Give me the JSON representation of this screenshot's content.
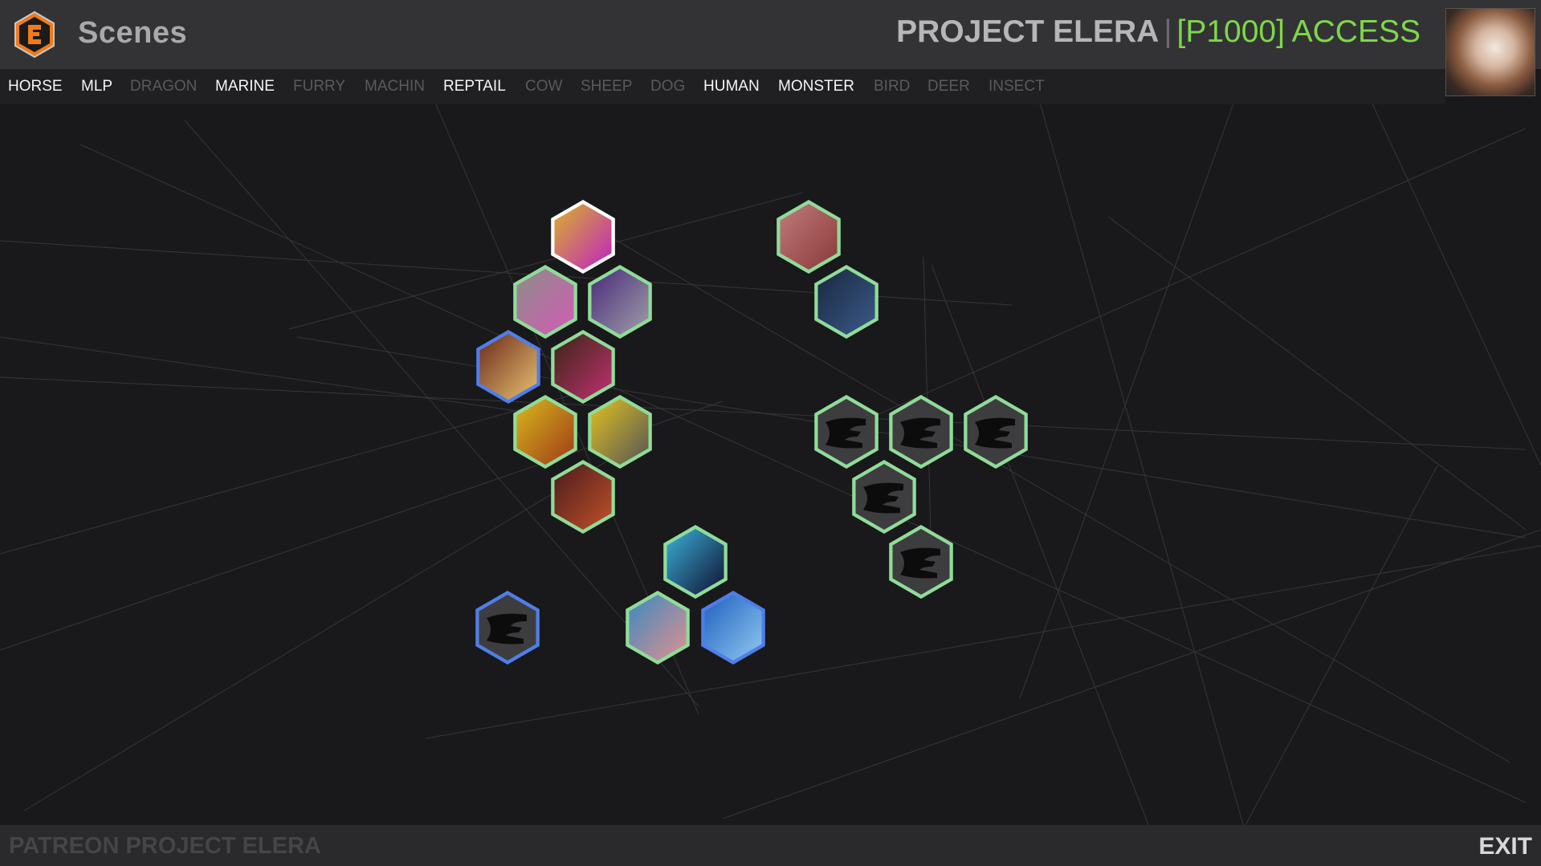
{
  "app": {
    "title": "Scenes",
    "project_name": "PROJECT ELERA",
    "separator": "|",
    "access_label": "[P1000] ACCESS"
  },
  "categories": [
    {
      "label": "HORSE",
      "active": true
    },
    {
      "label": "MLP",
      "active": true
    },
    {
      "label": "DRAGON",
      "active": false
    },
    {
      "label": "MARINE",
      "active": true
    },
    {
      "label": "FURRY",
      "active": false
    },
    {
      "label": "MACHIN",
      "active": false
    },
    {
      "label": "REPTAIL",
      "active": true
    },
    {
      "label": "COW",
      "active": false
    },
    {
      "label": "SHEEP",
      "active": false
    },
    {
      "label": "DOG",
      "active": false
    },
    {
      "label": "HUMAN",
      "active": true
    },
    {
      "label": "MONSTER",
      "active": true
    },
    {
      "label": "BIRD",
      "active": false
    },
    {
      "label": "DEER",
      "active": false
    },
    {
      "label": "INSECT",
      "active": false
    }
  ],
  "scenes": [
    {
      "name": "scene-yellow-pink-hair",
      "border": "white",
      "state": "selected",
      "thumb": [
        "#d9b22a",
        "#c022c0"
      ]
    },
    {
      "name": "scene-grey-pink",
      "border": "green",
      "state": "unlocked",
      "thumb": [
        "#8d8d86",
        "#d25bb8"
      ]
    },
    {
      "name": "scene-purple-stars",
      "border": "green",
      "state": "unlocked",
      "thumb": [
        "#4b2a7b",
        "#9e9ea8"
      ]
    },
    {
      "name": "scene-stable-sunset",
      "border": "blue",
      "state": "unlocked",
      "thumb": [
        "#6b2a1c",
        "#e8c070"
      ]
    },
    {
      "name": "scene-green-room",
      "border": "green",
      "state": "unlocked",
      "thumb": [
        "#3a2615",
        "#c03070"
      ]
    },
    {
      "name": "scene-yellow-body-1",
      "border": "green",
      "state": "unlocked",
      "thumb": [
        "#d6b81c",
        "#a03a18"
      ]
    },
    {
      "name": "scene-yellow-body-2",
      "border": "green",
      "state": "unlocked",
      "thumb": [
        "#e0c020",
        "#555555"
      ]
    },
    {
      "name": "scene-barn-night",
      "border": "green",
      "state": "unlocked",
      "thumb": [
        "#4a1c1c",
        "#c0502a"
      ]
    },
    {
      "name": "scene-flesh-close",
      "border": "green",
      "state": "unlocked",
      "thumb": [
        "#c07a7a",
        "#8a3a3a"
      ]
    },
    {
      "name": "scene-dark-blue",
      "border": "green",
      "state": "unlocked",
      "thumb": [
        "#1a2840",
        "#3a5a8a"
      ]
    },
    {
      "name": "scene-orca",
      "border": "green",
      "state": "unlocked",
      "thumb": [
        "#3ab0d8",
        "#101030"
      ]
    },
    {
      "name": "scene-water-pink",
      "border": "green",
      "state": "unlocked",
      "thumb": [
        "#3a8ac0",
        "#e09090"
      ]
    },
    {
      "name": "scene-pool",
      "border": "blue",
      "state": "unlocked",
      "thumb": [
        "#2060c0",
        "#90c8f0"
      ]
    },
    {
      "name": "scene-locked-1",
      "border": "green",
      "state": "locked",
      "thumb": []
    },
    {
      "name": "scene-locked-2",
      "border": "green",
      "state": "locked",
      "thumb": []
    },
    {
      "name": "scene-locked-3",
      "border": "green",
      "state": "locked",
      "thumb": []
    },
    {
      "name": "scene-locked-4",
      "border": "green",
      "state": "locked",
      "thumb": []
    },
    {
      "name": "scene-locked-5",
      "border": "green",
      "state": "locked",
      "thumb": []
    },
    {
      "name": "scene-locked-6",
      "border": "blue",
      "state": "locked",
      "thumb": []
    }
  ],
  "footer": {
    "left_label": "PATREON PROJECT ELERA",
    "exit_label": "EXIT"
  },
  "colors": {
    "background": "#19181b",
    "topbar": "#333335",
    "border_green": "#8fdc98",
    "border_blue": "#4f7ee8",
    "border_white": "#ffffff",
    "access": "#7dd84a",
    "logo": "#f07b1c"
  }
}
